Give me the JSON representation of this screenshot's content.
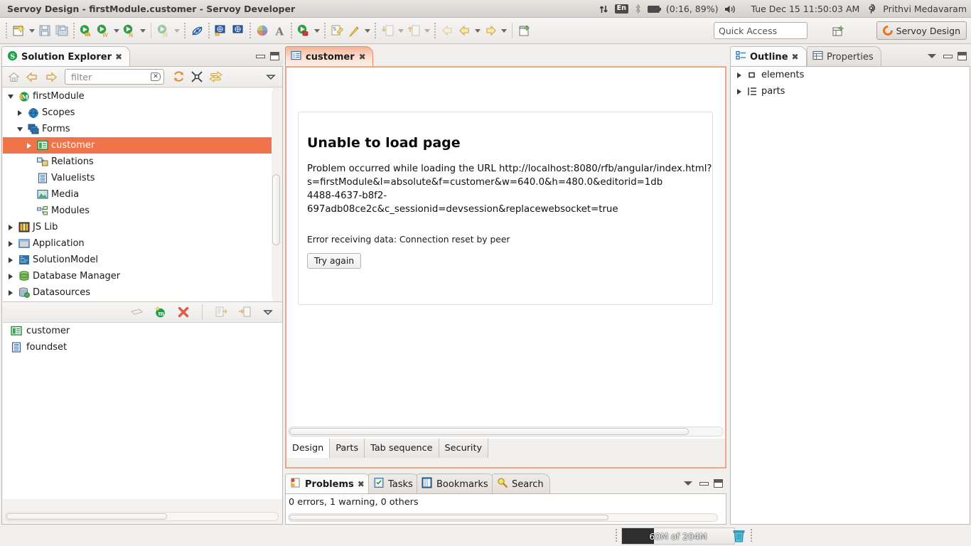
{
  "window": {
    "title": "Servoy Design - firstModule.customer - Servoy Developer"
  },
  "tray": {
    "network_icon": "network-updown-icon",
    "keyboard_layout": "En",
    "bluetooth_icon": "bluetooth-icon",
    "battery_icon": "battery-icon",
    "battery_status": "(0:16, 89%)",
    "volume_icon": "volume-icon",
    "datetime": "Tue Dec 15 11:50:03 AM",
    "settings_icon": "gear-icon",
    "username": "Prithvi Medavaram"
  },
  "toolbar": {
    "quick_access_placeholder": "Quick Access",
    "perspective_label": "Servoy Design",
    "items": [
      "new-wizard-icon",
      "new-wizard-dropdown",
      "save-icon",
      "save-all-icon",
      "debug-solution-icon",
      "run-web-client-icon",
      "run-web-client-dropdown",
      "run-ng-client-icon",
      "run-ng-client-dropdown",
      "run-mobile-client-icon",
      "run-mobile-client-dropdown",
      "stop-debug-icon",
      "i18n-export-icon",
      "i18n-import-icon",
      "color-picker-icon",
      "font-icon",
      "run-server-icon",
      "run-server-dropdown",
      "open-sql-editor-icon",
      "open-designer-icon",
      "open-designer-dropdown",
      "import-solution-icon",
      "import-dropdown",
      "export-solution-icon",
      "export-dropdown",
      "back-icon",
      "back-dropdown",
      "forward-icon",
      "forward-dropdown",
      "new-form-icon",
      "open-perspective-icon"
    ]
  },
  "solution_explorer": {
    "tab_label": "Solution Explorer",
    "tab_icon": "servoy-solution-icon",
    "toolbar": {
      "home_icon": "home-icon",
      "back_icon": "back-arrow-icon",
      "forward_icon": "forward-arrow-icon",
      "filter_placeholder": "filter",
      "clear_icon": "clear-filter-icon",
      "refresh_icon": "refresh-icon",
      "collapse_icon": "collapse-all-icon",
      "link_icon": "link-with-editor-icon",
      "menu_icon": "view-menu-icon"
    },
    "tree": [
      {
        "label": "firstModule",
        "icon": "module-icon",
        "indent": 0,
        "twisty": "open",
        "selected": false
      },
      {
        "label": "Scopes",
        "icon": "scopes-icon",
        "indent": 1,
        "twisty": "closed",
        "selected": false
      },
      {
        "label": "Forms",
        "icon": "forms-icon",
        "indent": 1,
        "twisty": "open",
        "selected": false
      },
      {
        "label": "customer",
        "icon": "form-icon",
        "indent": 2,
        "twisty": "closed",
        "selected": true
      },
      {
        "label": "Relations",
        "icon": "relations-icon",
        "indent": 2,
        "twisty": "none",
        "selected": false
      },
      {
        "label": "Valuelists",
        "icon": "valuelists-icon",
        "indent": 2,
        "twisty": "none",
        "selected": false
      },
      {
        "label": "Media",
        "icon": "media-icon",
        "indent": 2,
        "twisty": "none",
        "selected": false
      },
      {
        "label": "Modules",
        "icon": "modules-icon",
        "indent": 2,
        "twisty": "none",
        "selected": false
      },
      {
        "label": "JS Lib",
        "icon": "jslib-icon",
        "indent": 0,
        "twisty": "closed",
        "selected": false
      },
      {
        "label": "Application",
        "icon": "application-icon",
        "indent": 0,
        "twisty": "closed",
        "selected": false
      },
      {
        "label": "SolutionModel",
        "icon": "solutionmodel-icon",
        "indent": 0,
        "twisty": "closed",
        "selected": false
      },
      {
        "label": "Database Manager",
        "icon": "database-icon",
        "indent": 0,
        "twisty": "closed",
        "selected": false
      },
      {
        "label": "Datasources",
        "icon": "datasources-icon",
        "indent": 0,
        "twisty": "closed",
        "selected": false
      }
    ],
    "sub_toolbar": [
      "move-sample-icon",
      "new-method-icon",
      "delete-icon",
      "move-code-icon",
      "move-sample-code-icon",
      "view-menu-icon"
    ],
    "list": [
      {
        "label": "customer",
        "icon": "form-icon"
      },
      {
        "label": "foundset",
        "icon": "foundset-icon"
      }
    ]
  },
  "editor": {
    "tab_label": "customer",
    "tab_icon": "form-icon",
    "tab_close_icon": "close-icon",
    "error_page": {
      "heading": "Unable to load page",
      "body": "Problem occurred while loading the URL http://localhost:8080/rfb/angular/index.html?s=firstModule&l=absolute&f=customer&w=640.0&h=480.0&editorid=1db\n4488-4637-b8f2-\n697adb08ce2c&c_sessionid=devsession&replacewebsocket=true",
      "detail": "Error receiving data: Connection reset by peer",
      "button": "Try again"
    },
    "tabs": [
      {
        "label": "Design",
        "active": true
      },
      {
        "label": "Parts",
        "active": false
      },
      {
        "label": "Tab sequence",
        "active": false
      },
      {
        "label": "Security",
        "active": false
      }
    ]
  },
  "problems": {
    "tabs": [
      {
        "label": "Problems",
        "icon": "problems-icon",
        "active": true
      },
      {
        "label": "Tasks",
        "icon": "tasks-icon",
        "active": false
      },
      {
        "label": "Bookmarks",
        "icon": "bookmarks-icon",
        "active": false
      },
      {
        "label": "Search",
        "icon": "search-icon",
        "active": false
      }
    ],
    "close_icon": "close-icon",
    "status": "0 errors, 1 warning, 0 others"
  },
  "outline": {
    "tabs": [
      {
        "label": "Outline",
        "icon": "outline-icon",
        "active": true
      },
      {
        "label": "Properties",
        "icon": "properties-icon",
        "active": false
      }
    ],
    "close_icon": "close-icon",
    "tree": [
      {
        "label": "elements",
        "icon": "elements-icon"
      },
      {
        "label": "parts",
        "icon": "parts-icon"
      }
    ]
  },
  "statusbar": {
    "heap_label": "60M of 204M",
    "trash_icon": "trash-icon"
  },
  "colors": {
    "selection_orange": "#f0744a",
    "editor_tab_orange": "#eda883",
    "perspective_orange": "#f07022",
    "panel_bg": "#f2f0ef"
  }
}
